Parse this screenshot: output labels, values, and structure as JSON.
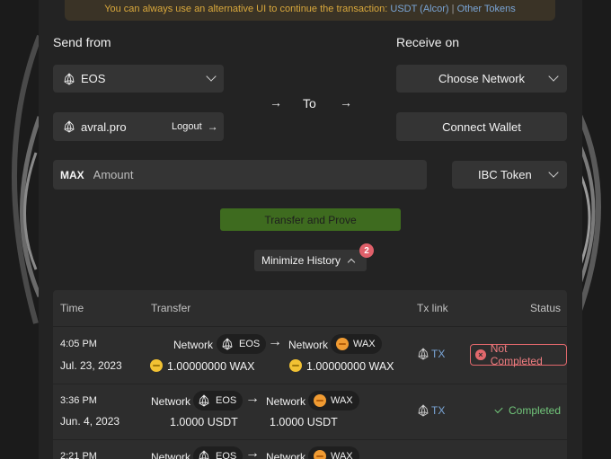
{
  "notice": {
    "text": "You can always use an alternative UI to continue the transaction:",
    "link_usdt": "USDT (Alcor)",
    "separator": "|",
    "link_other": "Other Tokens"
  },
  "send": {
    "label": "Send from",
    "network": "EOS",
    "account": "avral.pro",
    "logout": "Logout"
  },
  "middle": {
    "to": "To"
  },
  "receive": {
    "label": "Receive on",
    "network_placeholder": "Choose Network",
    "connect": "Connect Wallet"
  },
  "amount": {
    "max": "MAX",
    "placeholder": "Amount",
    "token": "IBC Token"
  },
  "actions": {
    "transfer": "Transfer and Prove",
    "history": "Minimize History",
    "badge_count": "2"
  },
  "table": {
    "headers": {
      "time": "Time",
      "transfer": "Transfer",
      "txlink": "Tx link",
      "status": "Status"
    },
    "rows": [
      {
        "time": "4:05 PM",
        "date": "Jul. 23, 2023",
        "from_label": "Network",
        "from_network": "EOS",
        "to_label": "Network",
        "to_network": "WAX",
        "from_amount": "1.00000000 WAX",
        "to_amount": "1.00000000 WAX",
        "tx": "TX",
        "status": "Not Completed"
      },
      {
        "time": "3:36 PM",
        "date": "Jun. 4, 2023",
        "from_label": "Network",
        "from_network": "EOS",
        "to_label": "Network",
        "to_network": "WAX",
        "from_amount": "1.0000 USDT",
        "to_amount": "1.0000 USDT",
        "tx": "TX",
        "status": "Completed"
      },
      {
        "time": "2:21 PM",
        "from_label": "Network",
        "from_network": "EOS",
        "to_label": "Network",
        "to_network": "WAX"
      }
    ]
  },
  "colors": {
    "accent_link": "#7aa5d6",
    "warning_text": "#d9a83c",
    "button_green": "#3e6b1f",
    "status_error": "#e2686c",
    "status_ok": "#72c77b",
    "wax_orange": "#f09b32"
  }
}
